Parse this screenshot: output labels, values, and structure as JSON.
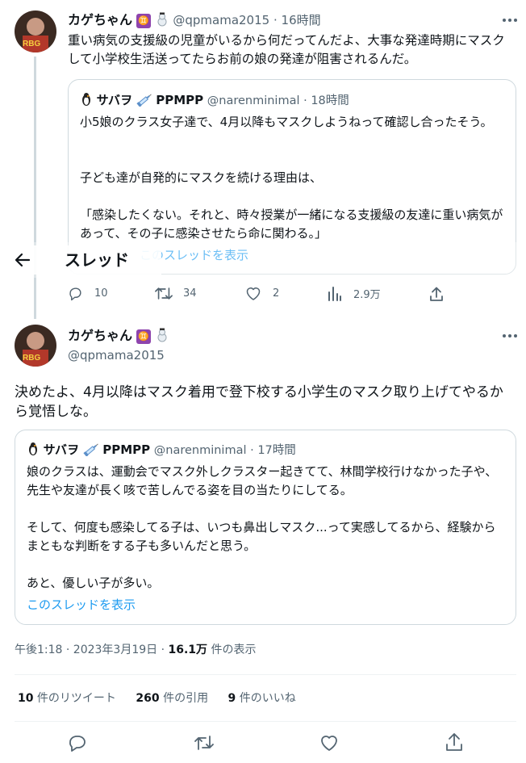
{
  "header": {
    "title": "スレッド"
  },
  "parent_tweet": {
    "author": "カゲちゃん",
    "handle": "@qpmama2015",
    "sep": "·",
    "time": "16時間",
    "text": "重い病気の支援級の児童がいるから何だってんだよ、大事な発達時期にマスクして小学校生活送ってたらお前の娘の発達が阻害されるんだ。",
    "quote": {
      "author": "サバヲ",
      "author_suffix": "PPMPP",
      "handle": "@narenminimal",
      "sep": "·",
      "time": "18時間",
      "lines": [
        "小5娘のクラス女子達で、4月以降もマスクしようねって確認し合ったそう。",
        "子ども達が自発的にマスクを続ける理由は、",
        "「感染したくない。それと、時々授業が一緒になる支援級の友達に重い病気があって、その子に感染させたら命に関わる。」"
      ],
      "show_thread": "このスレッドを表示"
    },
    "actions": {
      "replies": "10",
      "retweets": "34",
      "likes": "2",
      "views": "2.9万"
    }
  },
  "main_tweet": {
    "author": "カゲちゃん",
    "handle": "@qpmama2015",
    "text": "決めたよ、4月以降はマスク着用で登下校する小学生のマスク取り上げてやるから覚悟しな。",
    "quote": {
      "author": "サバヲ",
      "author_suffix": "PPMPP",
      "handle": "@narenminimal",
      "sep": "·",
      "time": "17時間",
      "para1": "娘のクラスは、運動会でマスク外しクラスター起きてて、林間学校行けなかった子や、先生や友達が長く咳で苦しんでる姿を目の当たりにしてる。",
      "para2": "そして、何度も感染してる子は、いつも鼻出しマスク...って実感してるから、経験からまともな判断をする子も多いんだと思う。",
      "para3": "あと、優しい子が多い。",
      "show_thread": "このスレッドを表示"
    },
    "meta": {
      "time": "午後1:18 · 2023年3月19日 · ",
      "views_count": "16.1万",
      "views_label": " 件の表示"
    },
    "stats": {
      "retweets_count": "10",
      "retweets_label": " 件のリツイート",
      "quotes_count": "260",
      "quotes_label": " 件の引用",
      "likes_count": "9",
      "likes_label": " 件のいいね"
    }
  },
  "icons": {
    "back": "arrow-left-icon",
    "more": "more-dots-icon",
    "reply": "reply-icon",
    "retweet": "retweet-icon",
    "like": "heart-icon",
    "views": "views-bar-icon",
    "share": "share-icon",
    "zodiac": "gemini-badge-icon",
    "snowman": "snowman-icon",
    "syringe": "syringe-icon",
    "penguin": "penguin-icon"
  },
  "colors": {
    "accent": "#1d9bf0",
    "text": "#0f1419",
    "secondary": "#536471",
    "border": "#cfd9de",
    "badge": "#8e44ad"
  }
}
